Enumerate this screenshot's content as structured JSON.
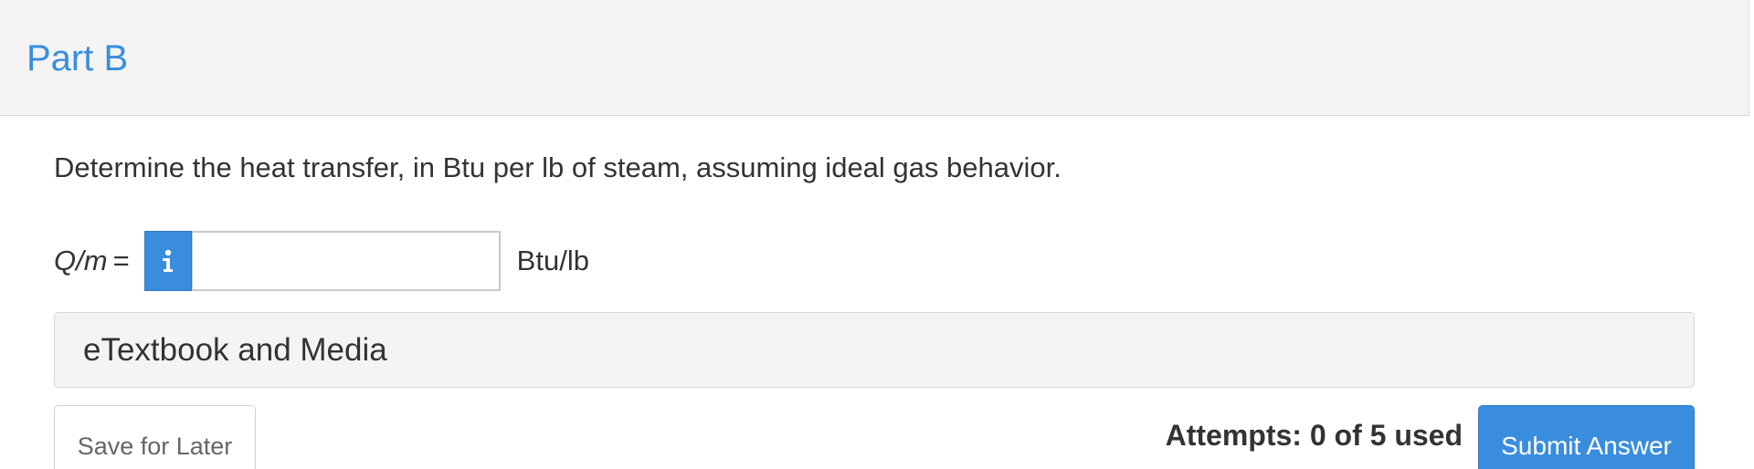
{
  "part": {
    "title": "Part B"
  },
  "question": {
    "text": "Determine the heat transfer, in Btu per lb of steam, assuming ideal gas behavior."
  },
  "answer": {
    "variable": "Q/m",
    "equals": "=",
    "info_icon": "info-icon",
    "input_value": "",
    "input_placeholder": "",
    "unit": "Btu/lb"
  },
  "media": {
    "label": "eTextbook and Media"
  },
  "footer": {
    "save_label": "Save for Later",
    "attempts_text": "Attempts: 0 of 5 used",
    "submit_label": "Submit Answer"
  },
  "colors": {
    "accent": "#3a8dde",
    "header_bg": "#f4f4f4",
    "text": "#333333"
  }
}
